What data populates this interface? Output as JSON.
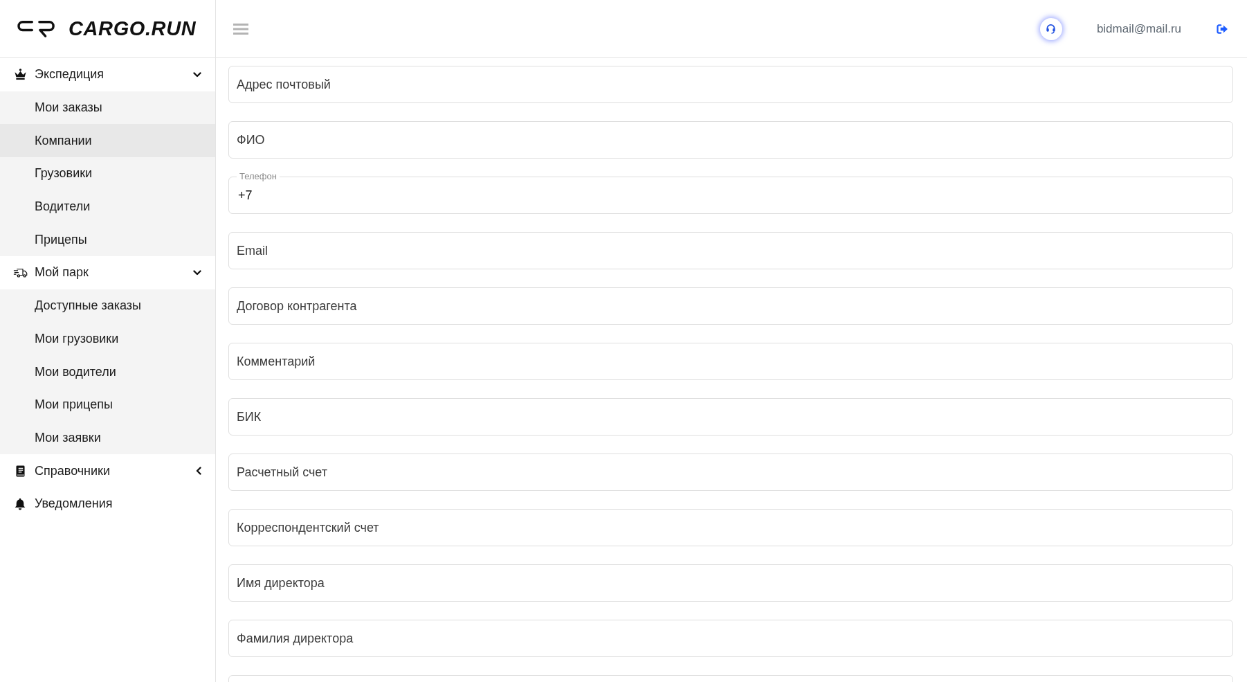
{
  "logo": {
    "text": "CARGO.RUN"
  },
  "header": {
    "email": "bidmail@mail.ru"
  },
  "sidebar": {
    "items": [
      {
        "kind": "group",
        "label": "Экспедиция",
        "expanded": true,
        "children": [
          {
            "label": "Мои заказы",
            "selected": false
          },
          {
            "label": "Компании",
            "selected": true
          },
          {
            "label": "Грузовики",
            "selected": false
          },
          {
            "label": "Водители",
            "selected": false
          },
          {
            "label": "Прицепы",
            "selected": false
          }
        ]
      },
      {
        "kind": "group",
        "label": "Мой парк",
        "expanded": true,
        "children": [
          {
            "label": "Доступные заказы",
            "selected": false
          },
          {
            "label": "Мои грузовики",
            "selected": false
          },
          {
            "label": "Мои водители",
            "selected": false
          },
          {
            "label": "Мои прицепы",
            "selected": false
          },
          {
            "label": "Мои заявки",
            "selected": false
          }
        ]
      },
      {
        "kind": "group",
        "label": "Справочники",
        "expanded": false
      },
      {
        "kind": "link",
        "label": "Уведомления"
      }
    ]
  },
  "form": {
    "fields": [
      {
        "kind": "plain",
        "placeholder": "Адрес почтовый"
      },
      {
        "kind": "plain",
        "placeholder": "ФИО"
      },
      {
        "kind": "outlined",
        "label": "Телефон",
        "value": "+7"
      },
      {
        "kind": "plain",
        "placeholder": "Email"
      },
      {
        "kind": "plain",
        "placeholder": "Договор контрагента"
      },
      {
        "kind": "plain",
        "placeholder": "Комментарий"
      },
      {
        "kind": "plain",
        "placeholder": "БИК"
      },
      {
        "kind": "plain",
        "placeholder": "Расчетный счет"
      },
      {
        "kind": "plain",
        "placeholder": "Корреспондентский счет"
      },
      {
        "kind": "plain",
        "placeholder": "Имя директора"
      },
      {
        "kind": "plain",
        "placeholder": "Фамилия директора"
      },
      {
        "kind": "plain"
      }
    ]
  }
}
